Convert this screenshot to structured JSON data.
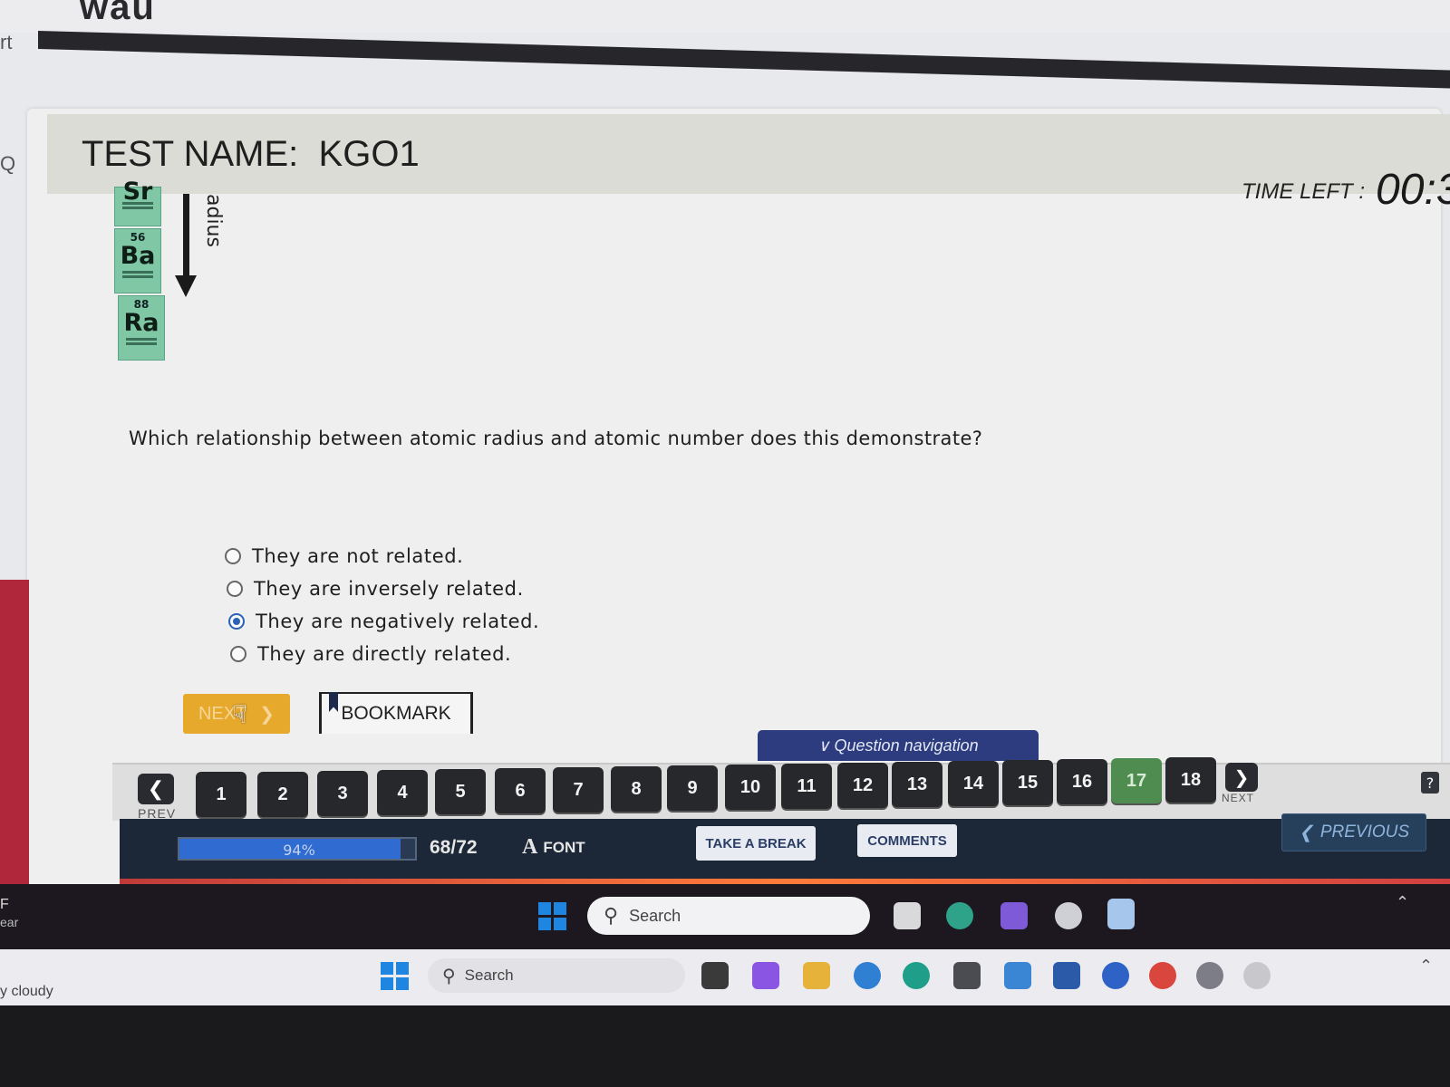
{
  "app": {
    "brand": "wau"
  },
  "side": {
    "top_fragment": "rt",
    "search_glyph": "Q",
    "weather_frag_1": "F",
    "weather_frag_2": "ear",
    "weather_text": "y cloudy"
  },
  "header": {
    "test_label": "TEST NAME:",
    "test_name": "KGO1",
    "time_label": "TIME LEFT :",
    "time_value": "00:3"
  },
  "figure": {
    "axis_label": "adius",
    "elements": [
      {
        "number": "",
        "symbol": "Sr"
      },
      {
        "number": "56",
        "symbol": "Ba"
      },
      {
        "number": "88",
        "symbol": "Ra"
      }
    ]
  },
  "question": {
    "text": "Which relationship between atomic radius and atomic number does this demonstrate?",
    "options": [
      {
        "label": "They are not related.",
        "selected": false
      },
      {
        "label": "They are inversely related.",
        "selected": false
      },
      {
        "label": "They are negatively related.",
        "selected": true
      },
      {
        "label": "They are directly related.",
        "selected": false
      }
    ]
  },
  "actions": {
    "next_label": "NEXT",
    "bookmark_label": "BOOKMARK"
  },
  "navigation": {
    "tab_label": "Question navigation",
    "prev_label": "PREV",
    "next_label": "NEXT",
    "questions": [
      "1",
      "2",
      "3",
      "4",
      "5",
      "6",
      "7",
      "8",
      "9",
      "10",
      "11",
      "12",
      "13",
      "14",
      "15",
      "16",
      "17",
      "18"
    ],
    "current": "17",
    "help_glyph": "?"
  },
  "footer": {
    "progress_percent": 94,
    "progress_text": "94%",
    "count": "68/72",
    "font_glyph": "A",
    "font_label": "FONT",
    "break_label": "TAKE A BREAK",
    "comments_label": "COMMENTS",
    "previous_label": "PREVIOUS"
  },
  "taskbar": {
    "search_label": "Search",
    "search_label_2": "Search"
  },
  "colors": {
    "accent_blue": "#2b62b8",
    "current_green": "#4f8c4f",
    "next_orange": "#e7a92c",
    "footer_navy": "#1c2838"
  }
}
